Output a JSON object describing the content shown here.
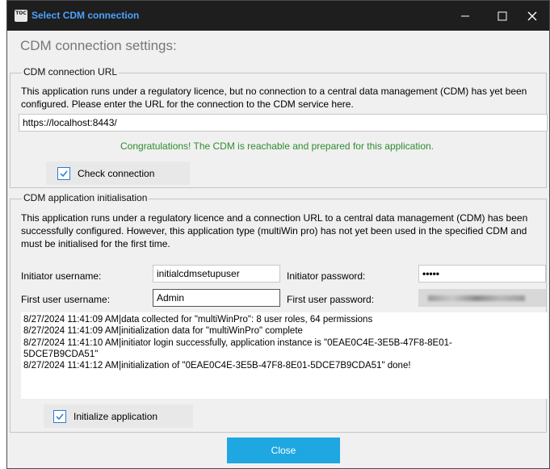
{
  "window": {
    "title": "Select CDM connection",
    "icon_text": "TOC"
  },
  "heading": "CDM connection settings:",
  "url_group": {
    "legend": "CDM connection URL",
    "description": "This application runs under a regulatory licence, but no connection to a central data management (CDM) has yet been configured. Please enter the URL for the connection to the CDM service here.",
    "url_value": "https://localhost:8443/",
    "status_message": "Congratulations! The CDM is reachable and prepared for this application.",
    "check_label": "Check connection",
    "check_checked": true
  },
  "init_group": {
    "legend": "CDM application initialisation",
    "description": "This application runs under a regulatory licence and a connection URL to a central data management (CDM) has been successfully configured. However, this application type (multiWin pro) has not yet been used in the specified CDM and must be initialised for the first time.",
    "initiator_username_label": "Initiator username:",
    "initiator_username_value": "initialcdmsetupuser",
    "initiator_password_label": "Initiator password:",
    "initiator_password_value": "•••••",
    "first_user_username_label": "First user username:",
    "first_user_username_value": "Admin",
    "first_user_password_label": "First user password:",
    "log_lines": [
      "8/27/2024 11:41:09 AM|data collected for \"multiWinPro\": 8 user roles, 64 permissions",
      "8/27/2024 11:41:09 AM|initialization data for \"multiWinPro\" complete",
      "8/27/2024 11:41:10 AM|initiator login successfully, application instance is \"0EAE0C4E-3E5B-47F8-8E01-",
      "5DCE7B9CDA51\"",
      "8/27/2024 11:41:12 AM|initialization of \"0EAE0C4E-3E5B-47F8-8E01-5DCE7B9CDA51\" done!"
    ],
    "init_label": "Initialize application",
    "init_checked": true
  },
  "close_label": "Close",
  "colors": {
    "titlebar_bg": "#1e1e1e",
    "title_text": "#4aa3ff",
    "success_text": "#2e8b2e",
    "accent": "#1ea7e1",
    "checkbox_border": "#2a7dd1"
  },
  "icons": {
    "minimize": "minimize-icon",
    "maximize": "maximize-icon",
    "close": "close-icon",
    "checkmark": "checkmark-icon"
  }
}
